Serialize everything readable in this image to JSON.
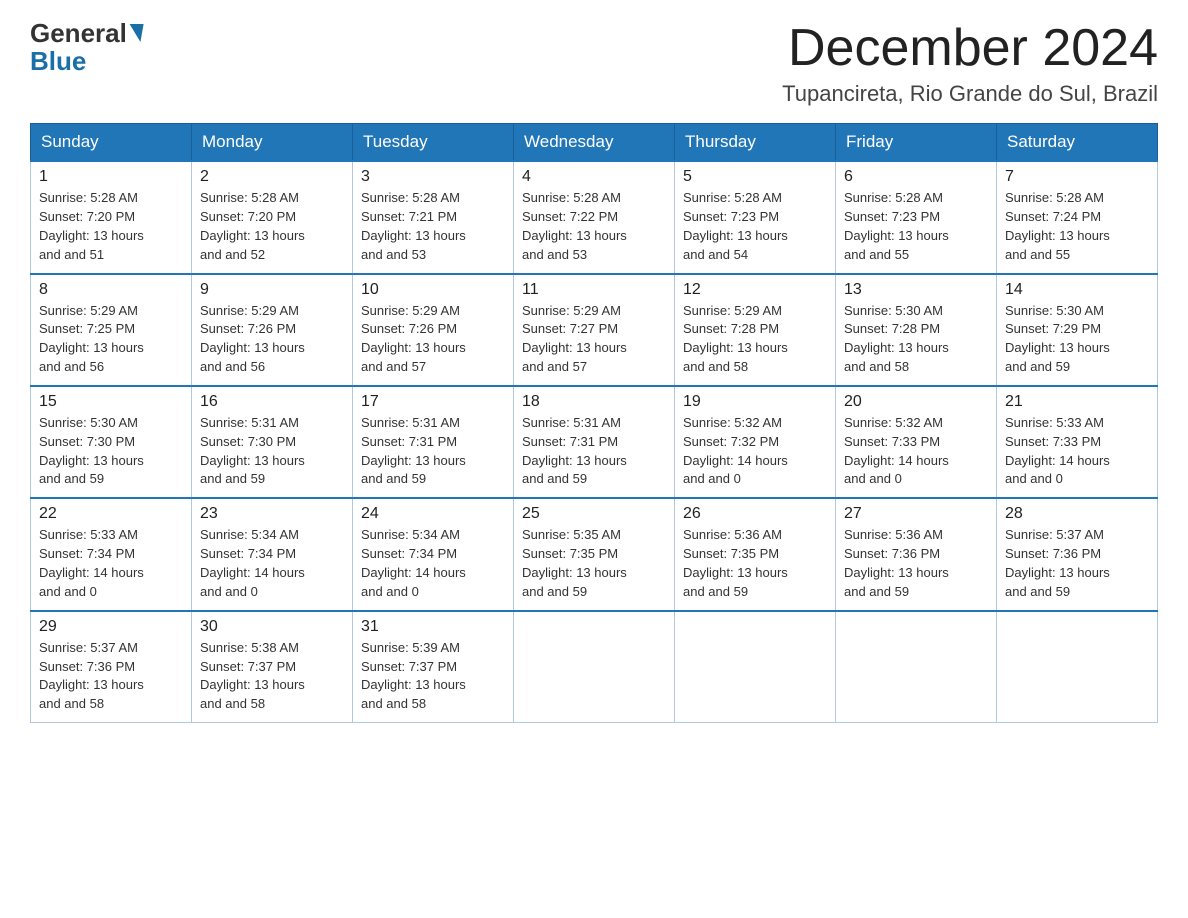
{
  "logo": {
    "general": "General",
    "blue": "Blue"
  },
  "header": {
    "month": "December 2024",
    "location": "Tupancireta, Rio Grande do Sul, Brazil"
  },
  "weekdays": [
    "Sunday",
    "Monday",
    "Tuesday",
    "Wednesday",
    "Thursday",
    "Friday",
    "Saturday"
  ],
  "weeks": [
    [
      {
        "day": "1",
        "sunrise": "5:28 AM",
        "sunset": "7:20 PM",
        "daylight": "13 hours and 51 minutes."
      },
      {
        "day": "2",
        "sunrise": "5:28 AM",
        "sunset": "7:20 PM",
        "daylight": "13 hours and 52 minutes."
      },
      {
        "day": "3",
        "sunrise": "5:28 AM",
        "sunset": "7:21 PM",
        "daylight": "13 hours and 53 minutes."
      },
      {
        "day": "4",
        "sunrise": "5:28 AM",
        "sunset": "7:22 PM",
        "daylight": "13 hours and 53 minutes."
      },
      {
        "day": "5",
        "sunrise": "5:28 AM",
        "sunset": "7:23 PM",
        "daylight": "13 hours and 54 minutes."
      },
      {
        "day": "6",
        "sunrise": "5:28 AM",
        "sunset": "7:23 PM",
        "daylight": "13 hours and 55 minutes."
      },
      {
        "day": "7",
        "sunrise": "5:28 AM",
        "sunset": "7:24 PM",
        "daylight": "13 hours and 55 minutes."
      }
    ],
    [
      {
        "day": "8",
        "sunrise": "5:29 AM",
        "sunset": "7:25 PM",
        "daylight": "13 hours and 56 minutes."
      },
      {
        "day": "9",
        "sunrise": "5:29 AM",
        "sunset": "7:26 PM",
        "daylight": "13 hours and 56 minutes."
      },
      {
        "day": "10",
        "sunrise": "5:29 AM",
        "sunset": "7:26 PM",
        "daylight": "13 hours and 57 minutes."
      },
      {
        "day": "11",
        "sunrise": "5:29 AM",
        "sunset": "7:27 PM",
        "daylight": "13 hours and 57 minutes."
      },
      {
        "day": "12",
        "sunrise": "5:29 AM",
        "sunset": "7:28 PM",
        "daylight": "13 hours and 58 minutes."
      },
      {
        "day": "13",
        "sunrise": "5:30 AM",
        "sunset": "7:28 PM",
        "daylight": "13 hours and 58 minutes."
      },
      {
        "day": "14",
        "sunrise": "5:30 AM",
        "sunset": "7:29 PM",
        "daylight": "13 hours and 59 minutes."
      }
    ],
    [
      {
        "day": "15",
        "sunrise": "5:30 AM",
        "sunset": "7:30 PM",
        "daylight": "13 hours and 59 minutes."
      },
      {
        "day": "16",
        "sunrise": "5:31 AM",
        "sunset": "7:30 PM",
        "daylight": "13 hours and 59 minutes."
      },
      {
        "day": "17",
        "sunrise": "5:31 AM",
        "sunset": "7:31 PM",
        "daylight": "13 hours and 59 minutes."
      },
      {
        "day": "18",
        "sunrise": "5:31 AM",
        "sunset": "7:31 PM",
        "daylight": "13 hours and 59 minutes."
      },
      {
        "day": "19",
        "sunrise": "5:32 AM",
        "sunset": "7:32 PM",
        "daylight": "14 hours and 0 minutes."
      },
      {
        "day": "20",
        "sunrise": "5:32 AM",
        "sunset": "7:33 PM",
        "daylight": "14 hours and 0 minutes."
      },
      {
        "day": "21",
        "sunrise": "5:33 AM",
        "sunset": "7:33 PM",
        "daylight": "14 hours and 0 minutes."
      }
    ],
    [
      {
        "day": "22",
        "sunrise": "5:33 AM",
        "sunset": "7:34 PM",
        "daylight": "14 hours and 0 minutes."
      },
      {
        "day": "23",
        "sunrise": "5:34 AM",
        "sunset": "7:34 PM",
        "daylight": "14 hours and 0 minutes."
      },
      {
        "day": "24",
        "sunrise": "5:34 AM",
        "sunset": "7:34 PM",
        "daylight": "14 hours and 0 minutes."
      },
      {
        "day": "25",
        "sunrise": "5:35 AM",
        "sunset": "7:35 PM",
        "daylight": "13 hours and 59 minutes."
      },
      {
        "day": "26",
        "sunrise": "5:36 AM",
        "sunset": "7:35 PM",
        "daylight": "13 hours and 59 minutes."
      },
      {
        "day": "27",
        "sunrise": "5:36 AM",
        "sunset": "7:36 PM",
        "daylight": "13 hours and 59 minutes."
      },
      {
        "day": "28",
        "sunrise": "5:37 AM",
        "sunset": "7:36 PM",
        "daylight": "13 hours and 59 minutes."
      }
    ],
    [
      {
        "day": "29",
        "sunrise": "5:37 AM",
        "sunset": "7:36 PM",
        "daylight": "13 hours and 58 minutes."
      },
      {
        "day": "30",
        "sunrise": "5:38 AM",
        "sunset": "7:37 PM",
        "daylight": "13 hours and 58 minutes."
      },
      {
        "day": "31",
        "sunrise": "5:39 AM",
        "sunset": "7:37 PM",
        "daylight": "13 hours and 58 minutes."
      },
      null,
      null,
      null,
      null
    ]
  ],
  "labels": {
    "sunrise": "Sunrise:",
    "sunset": "Sunset:",
    "daylight": "Daylight:"
  }
}
